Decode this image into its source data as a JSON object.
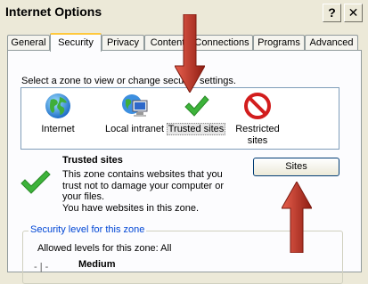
{
  "window": {
    "title": "Internet Options",
    "help_button": "?",
    "close_button": "✕"
  },
  "tabs": [
    {
      "label": "General"
    },
    {
      "label": "Security"
    },
    {
      "label": "Privacy"
    },
    {
      "label": "Content"
    },
    {
      "label": "Connections"
    },
    {
      "label": "Programs"
    },
    {
      "label": "Advanced"
    }
  ],
  "zones": {
    "prompt": "Select a zone to view or change security settings.",
    "items": [
      {
        "label_line1": "Internet",
        "label_line2": "",
        "icon": "globe-icon"
      },
      {
        "label_line1": "Local intranet",
        "label_line2": "",
        "icon": "intranet-icon"
      },
      {
        "label_line1": "Trusted sites",
        "label_line2": "",
        "icon": "checkmark-icon"
      },
      {
        "label_line1": "Restricted",
        "label_line2": "sites",
        "icon": "prohibited-icon"
      }
    ],
    "selected": "Trusted sites"
  },
  "detail": {
    "title": "Trusted sites",
    "desc_line1": "This zone contains websites that you",
    "desc_line2": "trust not to damage your computer or",
    "desc_line3": "your files.",
    "desc_line4": "You have websites in this zone.",
    "sites_button": "Sites"
  },
  "security_level": {
    "group_label": "Security level for this zone",
    "allowed": "Allowed levels for this zone: All",
    "level": "Medium",
    "slider_mark": "- | -"
  },
  "colors": {
    "accent_arrow": "#c0392b",
    "tab_highlight": "#ffc83c",
    "group_label": "#0046d5"
  }
}
